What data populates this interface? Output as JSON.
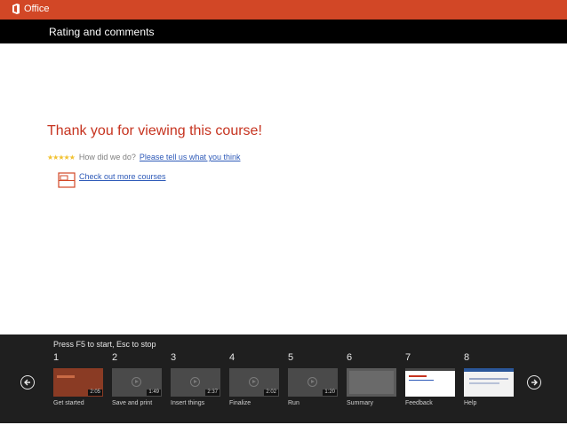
{
  "app": {
    "brand": "Office",
    "logo_icon": "office-logo-icon"
  },
  "header": {
    "title": "Rating and comments"
  },
  "main": {
    "thanks": "Thank you for viewing this course!",
    "rating_question": "How did we do?",
    "rating_link": "Please tell us what you think",
    "more_link": "Check out more courses"
  },
  "footer": {
    "hint": "Press F5 to start, Esc to stop",
    "slides": [
      {
        "number": "1",
        "label": "Get started",
        "duration": "2:05"
      },
      {
        "number": "2",
        "label": "Save and print",
        "duration": "1:49"
      },
      {
        "number": "3",
        "label": "Insert things",
        "duration": "2:37"
      },
      {
        "number": "4",
        "label": "Finalize",
        "duration": "2:02"
      },
      {
        "number": "5",
        "label": "Run",
        "duration": "1:20"
      },
      {
        "number": "6",
        "label": "Summary"
      },
      {
        "number": "7",
        "label": "Feedback"
      },
      {
        "number": "8",
        "label": "Help"
      }
    ]
  },
  "colors": {
    "brand_bar": "#d24726",
    "title_bar": "#000000",
    "heading": "#c6331f",
    "link": "#2e5ab8",
    "star": "#f2c230",
    "footer_bg": "#1f1f1f"
  }
}
